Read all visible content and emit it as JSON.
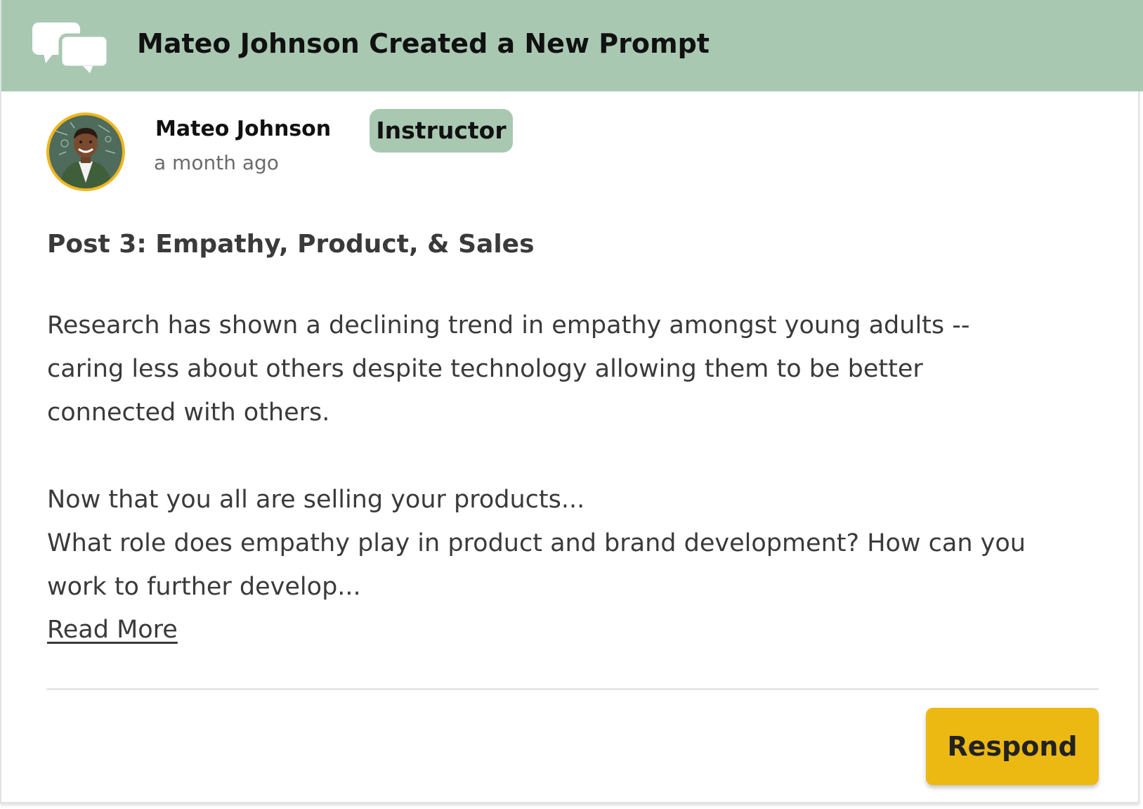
{
  "notification": {
    "title": "Mateo Johnson Created a New Prompt",
    "icon": "chat-bubbles-icon"
  },
  "author": {
    "name": "Mateo Johnson",
    "time_ago": "a month ago",
    "role_badge": "Instructor",
    "avatar": "instructor-portrait"
  },
  "post": {
    "title": "Post 3: Empathy, Product, & Sales",
    "paragraph1_lines": [
      "Research has shown a declining trend in empathy amongst young adults --",
      "caring less about others despite technology allowing them to be better",
      "connected with others."
    ],
    "paragraph2_lines": [
      "Now that you all are selling your products...",
      "What role does empathy play in product and brand development? How can you",
      "work to further develop..."
    ],
    "read_more_label": "Read More"
  },
  "actions": {
    "respond_label": "Respond"
  },
  "colors": {
    "banner": "#a9c8b2",
    "badge": "#a9c8b2",
    "avatar_ring": "#f0b61d",
    "respond_button": "#ecb913",
    "body_text": "#3a3a3a",
    "muted_text": "#6b6b6b"
  }
}
